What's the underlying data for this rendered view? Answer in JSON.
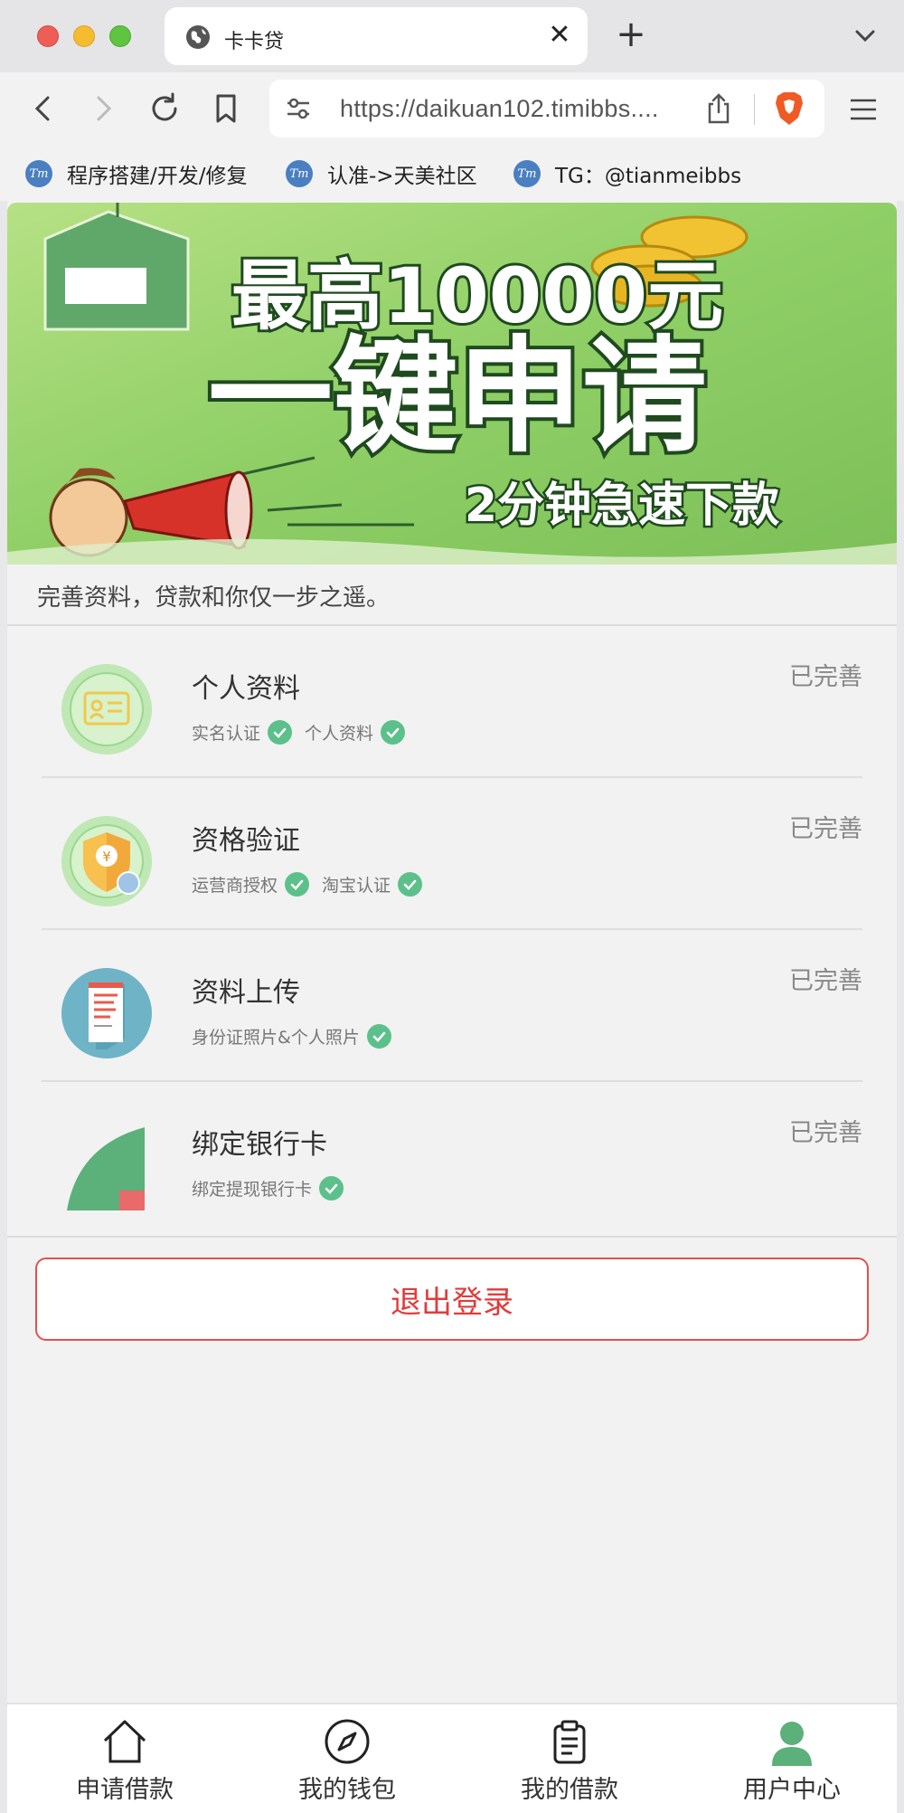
{
  "browser": {
    "tab_title": "卡卡贷",
    "url": "https://daikuan102.timibbs....",
    "bookmarks": [
      {
        "icon_text": "Tm",
        "label": "程序搭建/开发/修复"
      },
      {
        "icon_text": "Tm",
        "label": "认准->天美社区"
      },
      {
        "icon_text": "Tm",
        "label": "TG：@tianmeibbs"
      }
    ]
  },
  "banner": {
    "line1": "最高10000元",
    "line2": "一键申请",
    "line3": "2分钟急速下款"
  },
  "intro": "完善资料，贷款和你仅一步之遥。",
  "items": [
    {
      "title": "个人资料",
      "status": "已完善",
      "tags": [
        "实名认证",
        "个人资料"
      ],
      "icon": "id-card-icon"
    },
    {
      "title": "资格验证",
      "status": "已完善",
      "tags": [
        "运营商授权",
        "淘宝认证"
      ],
      "icon": "shield-yen-icon"
    },
    {
      "title": "资料上传",
      "status": "已完善",
      "tags": [
        "身份证照片&个人照片"
      ],
      "icon": "document-upload-icon"
    },
    {
      "title": "绑定银行卡",
      "status": "已完善",
      "tags": [
        "绑定提现银行卡"
      ],
      "icon": "bank-card-icon"
    }
  ],
  "logout_label": "退出登录",
  "bottom_nav": [
    {
      "label": "申请借款",
      "icon": "home-icon"
    },
    {
      "label": "我的钱包",
      "icon": "compass-icon"
    },
    {
      "label": "我的借款",
      "icon": "clipboard-icon"
    },
    {
      "label": "用户中心",
      "icon": "user-icon",
      "active": true
    }
  ],
  "colors": {
    "accent_green": "#5cc08a",
    "logout_red": "#e23b3b",
    "banner_green": "#8ccf64"
  }
}
